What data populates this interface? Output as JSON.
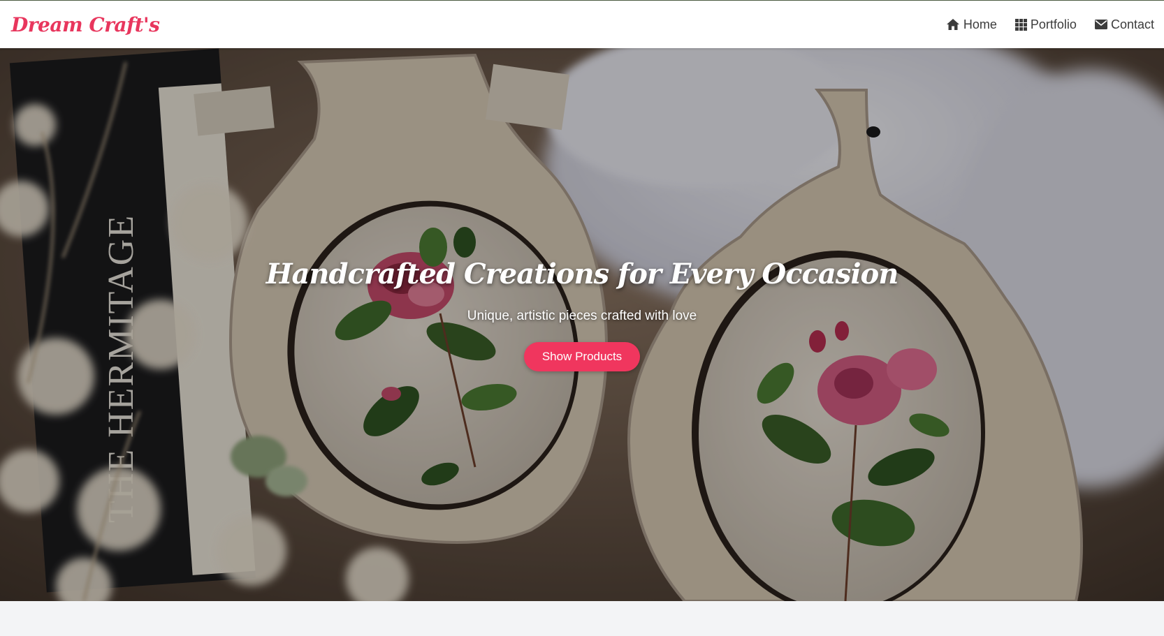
{
  "navbar": {
    "brand": "Dream Craft's",
    "items": [
      {
        "label": "Home",
        "icon": "home-icon"
      },
      {
        "label": "Portfolio",
        "icon": "grid-icon"
      },
      {
        "label": "Contact",
        "icon": "envelope-icon"
      }
    ]
  },
  "hero": {
    "title": "Handcrafted Creations for Every Occasion",
    "subtitle": "Unique, artistic pieces crafted with love",
    "button_label": "Show Products",
    "book_text": "THE HERMITAGE"
  },
  "colors": {
    "brand": "#e8365d",
    "button": "#f0365e",
    "nav_text": "#3c3c3c",
    "footer_bg": "#f3f4f6"
  }
}
